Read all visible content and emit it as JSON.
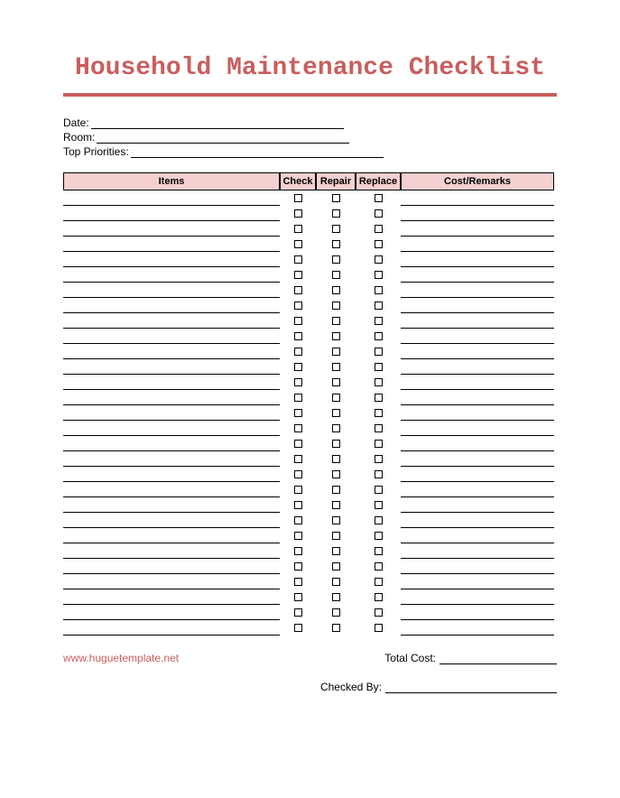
{
  "title": "Household Maintenance Checklist",
  "meta": {
    "date_label": "Date:",
    "room_label": "Room:",
    "priorities_label": "Top Priorities:",
    "date_value": "",
    "room_value": "",
    "priorities_value": ""
  },
  "columns": {
    "items": "Items",
    "check": "Check",
    "repair": "Repair",
    "replace": "Replace",
    "cost": "Cost/Remarks"
  },
  "row_count": 29,
  "footer": {
    "brand": "www.huguetemplate.net",
    "total_label": "Total Cost:",
    "total_value": "",
    "checked_label": "Checked By:",
    "checked_value": ""
  }
}
